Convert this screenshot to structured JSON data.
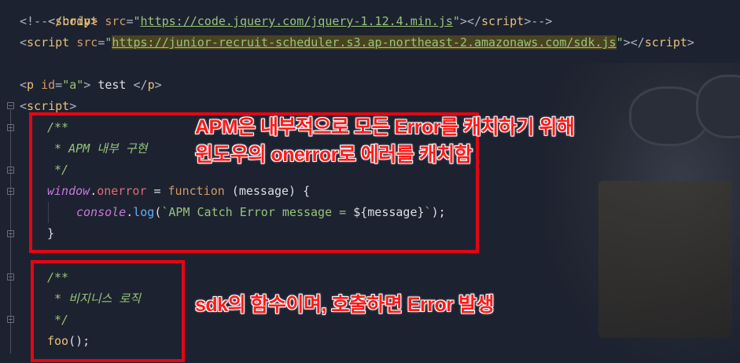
{
  "code": {
    "line_body_close": "</body>",
    "line_jquery": {
      "open": "<!--<",
      "tag": "script",
      "attr": " src",
      "eq": "=",
      "q1": "\"",
      "url": "https://code.jquery.com/jquery-1.12.4.min.js",
      "q2": "\"",
      "close": "></",
      "tag2": "script",
      "end": ">-->"
    },
    "line_sdk": {
      "open": "<",
      "tag": "script",
      "attr": " src",
      "eq": "=",
      "q1": "\"",
      "url": "https://junior-recruit-scheduler.s3.ap-northeast-2.amazonaws.com/sdk.js",
      "q2": "\"",
      "close": "></",
      "tag2": "script",
      "end": ">"
    },
    "line_p": {
      "open": "<",
      "tag": "p",
      "attr": " id",
      "eq": "=",
      "val": "\"a\"",
      "gt": ">",
      "text": " test ",
      "close": "</",
      "tag2": "p",
      "end": ">"
    },
    "line_script_open": {
      "open": "<",
      "tag": "script",
      "end": ">"
    },
    "comment1": [
      "/**",
      " * APM 내부 구현",
      " */"
    ],
    "line_onerror": {
      "obj": "window",
      "dot": ".",
      "prop": "onerror",
      "eq": " = ",
      "kw": "function",
      "args": " (message) {"
    },
    "line_console": {
      "obj": "console",
      "dot": ".",
      "fn": "log",
      "paren": "(",
      "tpl1": "`APM Catch Error message = ",
      "tplvar": "${message}",
      "tpl2": "`",
      "end": ");"
    },
    "line_close_brace": "}",
    "comment2": [
      "/**",
      " * 비지니스 로직",
      " */"
    ],
    "line_foo": {
      "fn": "foo",
      "end": "();"
    }
  },
  "annotations": {
    "apm_line1": "APM은 내부적으로 모든 Error를 캐치하기 위해",
    "apm_line2": "윈도우의 onerror로 에러를 캐치함",
    "sdk_note": "sdk의 함수이며, 호출하면 Error 발생"
  },
  "colors": {
    "background": "#1d2230",
    "annotation_red": "#e30613",
    "string": "#98c379",
    "tag": "#e5c07b",
    "keyword": "#c678dd"
  }
}
